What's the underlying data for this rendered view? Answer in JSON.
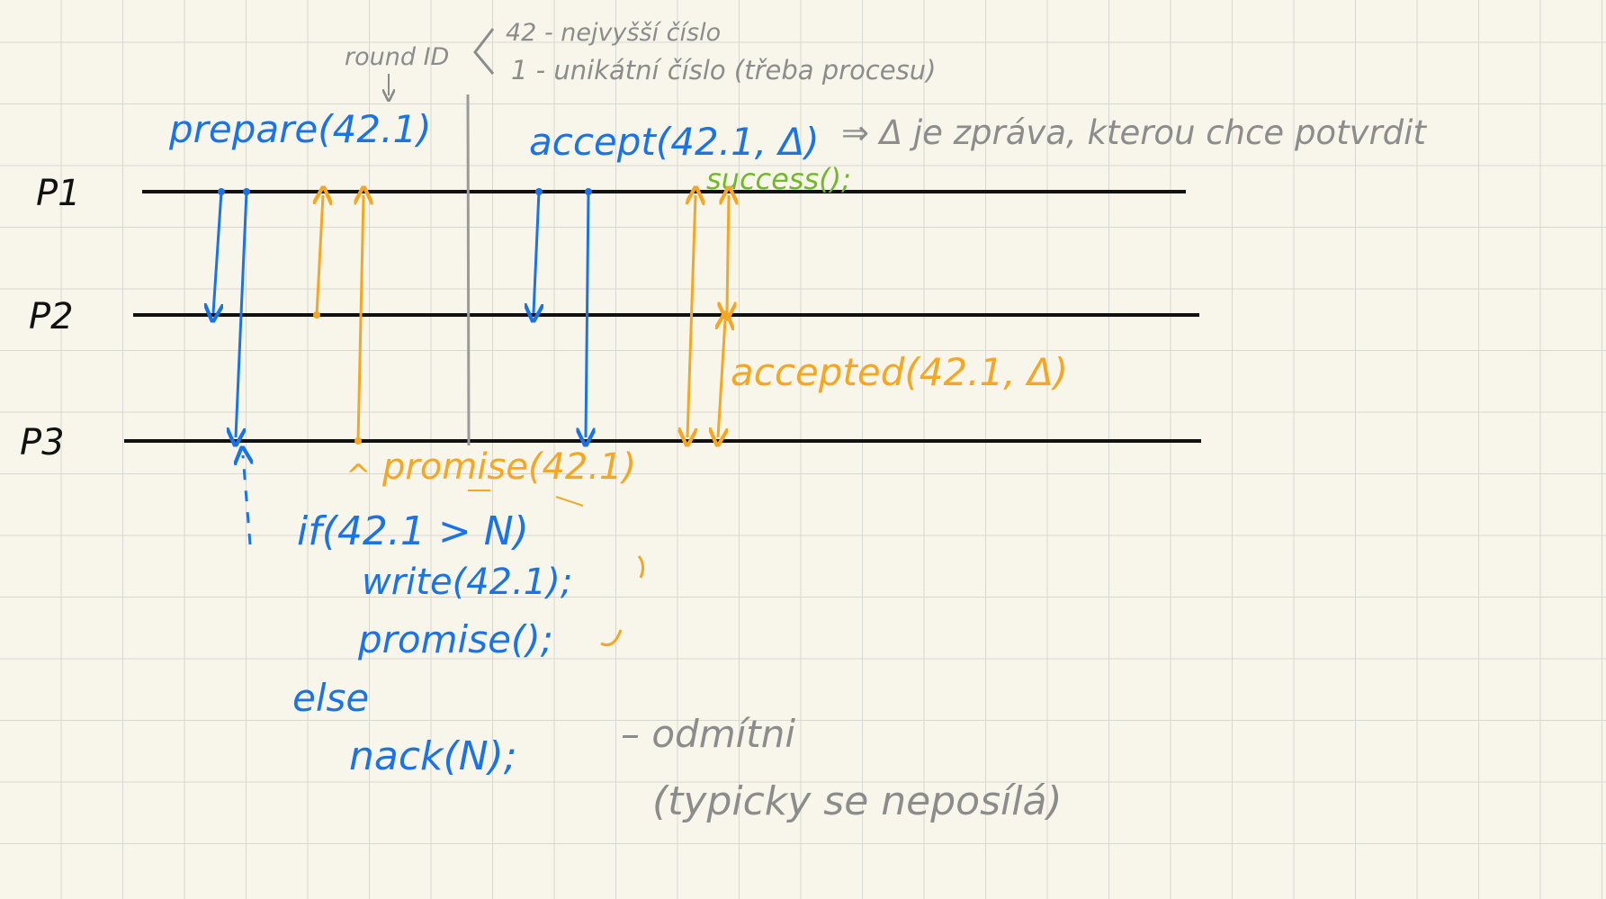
{
  "processes": [
    "P1",
    "P2",
    "P3"
  ],
  "round_id": {
    "label": "round ID",
    "part1": "42 - nejvyšší číslo",
    "part2": "1 - unikátní číslo (třeba procesu)"
  },
  "phase1": {
    "prepare": "prepare(42.1)",
    "promise": "promise(42.1)"
  },
  "phase2": {
    "accept": "accept(42.1, Δ)",
    "accept_note": "⇒ Δ je zpráva, kterou chce potvrdit",
    "success": "success();",
    "accepted": "accepted(42.1, Δ)"
  },
  "code": {
    "line1": "if(42.1 > N)",
    "line2": "write(42.1);",
    "line3": "promise();",
    "line4": "else",
    "line5": "nack(N);"
  },
  "nack_note": {
    "line1": "– odmítni",
    "line2": "(typicky se neposílá)"
  },
  "colors": {
    "blue": "#1a73e8",
    "orange": "#f5a623",
    "green": "#73b72d",
    "gray": "#8c8c8c",
    "black": "#111111"
  }
}
